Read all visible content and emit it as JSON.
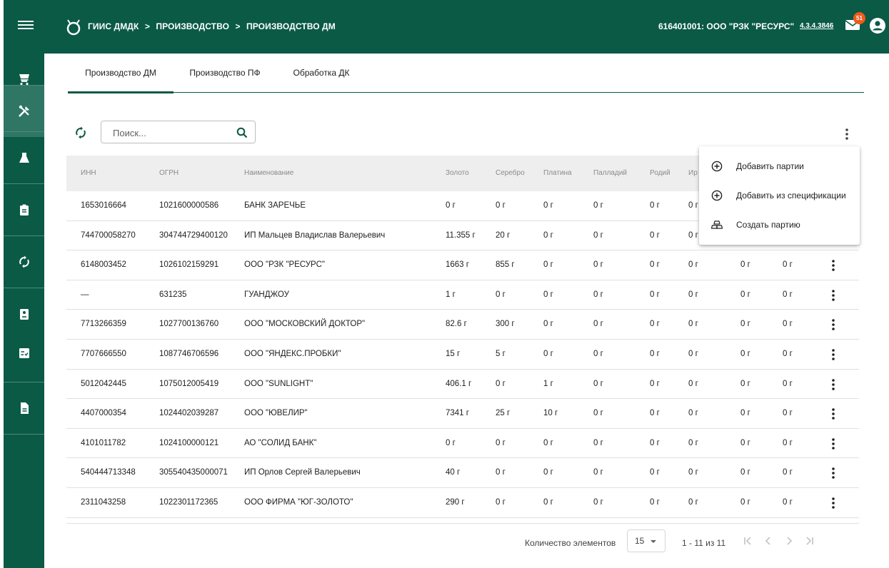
{
  "header": {
    "breadcrumb": [
      "ГИИС ДМДК",
      ">",
      "ПРОИЗВОДСТВО",
      ">",
      "ПРОИЗВОДСТВО ДМ"
    ],
    "org": "616401001: ООО \"РЗК \"РЕСУРС\"",
    "version": "4.3.4.3846",
    "mail_count": "51"
  },
  "sidebar": {
    "items": [
      {
        "icon": "cart-icon"
      },
      {
        "icon": "tools-icon",
        "active": true
      },
      {
        "icon": "flask-icon"
      },
      {
        "icon": "clipboard-icon"
      },
      {
        "icon": "sync-icon"
      },
      {
        "icon": "badge-icon"
      },
      {
        "icon": "checklist-icon"
      },
      {
        "icon": "document-icon"
      }
    ]
  },
  "tabs": [
    "Производство ДМ",
    "Производство ПФ",
    "Обработка ДК"
  ],
  "search": {
    "placeholder": "Поиск..."
  },
  "table": {
    "columns": [
      "ИНН",
      "ОГРН",
      "Наименование",
      "Золото",
      "Серебро",
      "Платина",
      "Палладий",
      "Родий",
      "Ир"
    ],
    "rows": [
      [
        "1653016664",
        "1021600000586",
        "БАНК ЗАРЕЧЬЕ",
        "0 г",
        "0 г",
        "0 г",
        "0 г",
        "0 г",
        "0 г",
        "",
        ""
      ],
      [
        "744700058270",
        "304744729400120",
        "ИП Мальцев Владислав Валерьевич",
        "11.355 г",
        "20 г",
        "0 г",
        "0 г",
        "0 г",
        "0 г",
        "",
        ""
      ],
      [
        "6148003452",
        "1026102159291",
        "ООО \"РЗК \"РЕСУРС\"",
        "1663 г",
        "855 г",
        "0 г",
        "0 г",
        "0 г",
        "0 г",
        "0 г",
        "0 г"
      ],
      [
        "—",
        "631235",
        "ГУАНДЖОУ",
        "1 г",
        "0 г",
        "0 г",
        "0 г",
        "0 г",
        "0 г",
        "0 г",
        "0 г"
      ],
      [
        "7713266359",
        "1027700136760",
        "ООО \"МОСКОВСКИЙ ДОКТОР\"",
        "82.6 г",
        "300 г",
        "0 г",
        "0 г",
        "0 г",
        "0 г",
        "0 г",
        "0 г"
      ],
      [
        "7707666550",
        "1087746706596",
        "ООО \"ЯНДЕКС.ПРОБКИ\"",
        "15 г",
        "5 г",
        "0 г",
        "0 г",
        "0 г",
        "0 г",
        "0 г",
        "0 г"
      ],
      [
        "5012042445",
        "1075012005419",
        "ООО \"SUNLIGHT\"",
        "406.1 г",
        "0 г",
        "1 г",
        "0 г",
        "0 г",
        "0 г",
        "0 г",
        "0 г"
      ],
      [
        "4407000354",
        "1024402039287",
        "ООО \"ЮВЕЛИР\"",
        "7341 г",
        "25 г",
        "10 г",
        "0 г",
        "0 г",
        "0 г",
        "0 г",
        "0 г"
      ],
      [
        "4101011782",
        "1024100000121",
        "АО \"СОЛИД БАНК\"",
        "0 г",
        "0 г",
        "0 г",
        "0 г",
        "0 г",
        "0 г",
        "0 г",
        "0 г"
      ],
      [
        "540444713348",
        "305540435000071",
        "ИП Орлов Сергей Валерьевич",
        "40 г",
        "0 г",
        "0 г",
        "0 г",
        "0 г",
        "0 г",
        "0 г",
        "0 г"
      ],
      [
        "2311043258",
        "1022301172365",
        "ООО ФИРМА \"ЮГ-ЗОЛОТО\"",
        "290 г",
        "0 г",
        "0 г",
        "0 г",
        "0 г",
        "0 г",
        "0 г",
        "0 г"
      ]
    ]
  },
  "menu": {
    "items": [
      {
        "label": "Добавить партии",
        "icon": "plus-circle-icon"
      },
      {
        "label": "Добавить из спецификации",
        "icon": "plus-circle-icon"
      },
      {
        "label": "Создать партию",
        "icon": "gold-bars-icon"
      }
    ]
  },
  "pager": {
    "label": "Количество элементов",
    "page_size": "15",
    "range": "1 - 11 из 11"
  },
  "colors": {
    "brand": "#0a5a46",
    "badge": "#ef5a1b"
  }
}
